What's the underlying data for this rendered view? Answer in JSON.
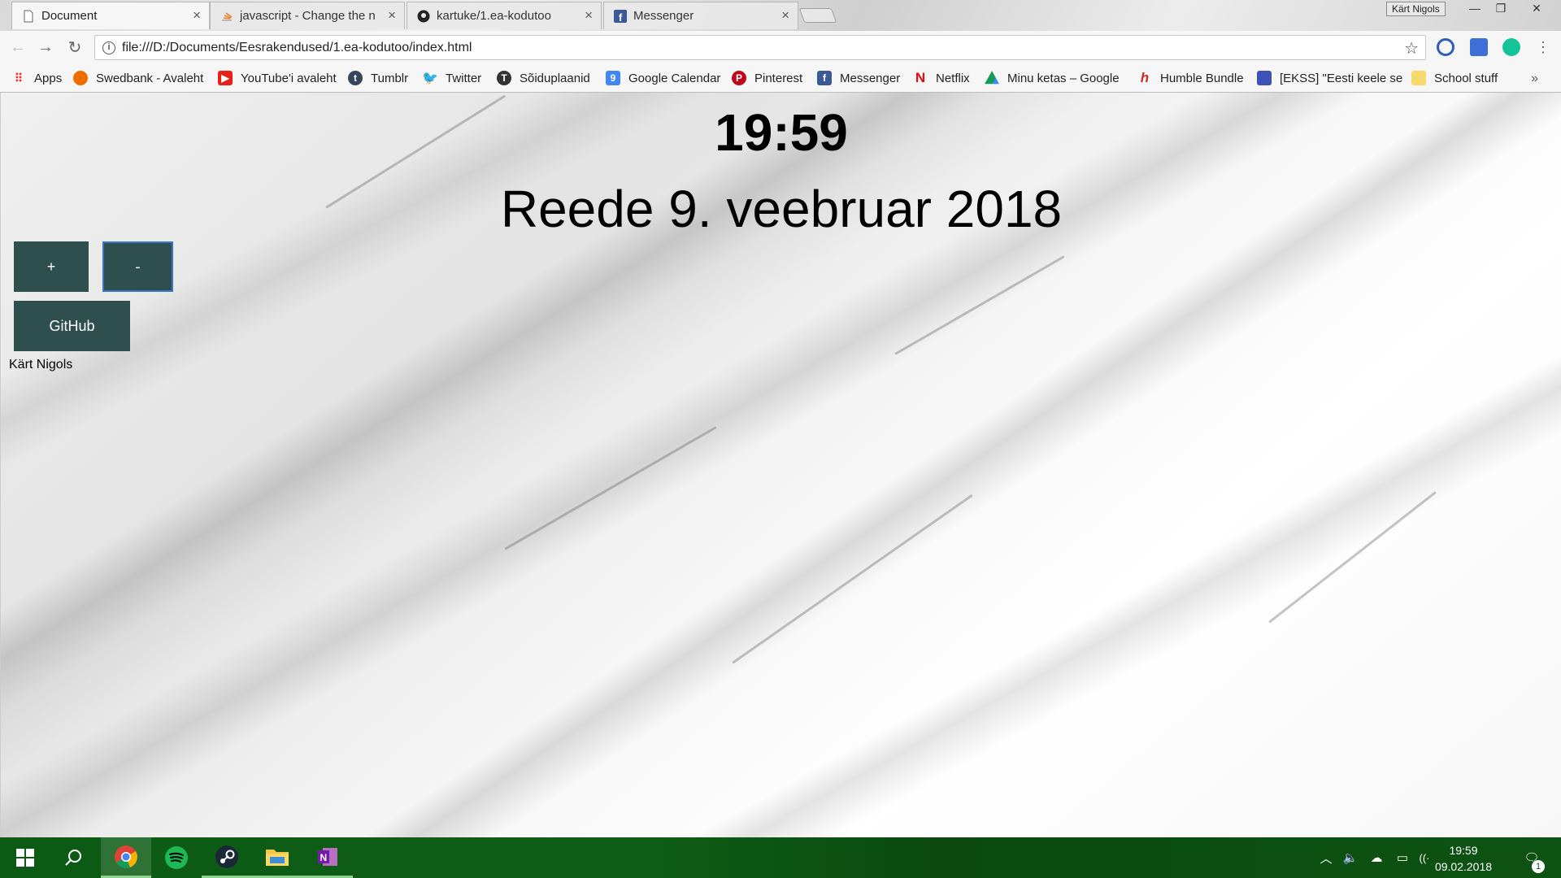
{
  "browser": {
    "tabs": [
      {
        "title": "Document",
        "icon": "page-icon"
      },
      {
        "title": "javascript - Change the n",
        "icon": "stackoverflow-icon"
      },
      {
        "title": "kartuke/1.ea-kodutoo",
        "icon": "github-icon"
      },
      {
        "title": "Messenger",
        "icon": "facebook-icon"
      }
    ],
    "profile": "Kärt Nigols",
    "url": "file:///D:/Documents/Eesrakendused/1.ea-kodutoo/index.html"
  },
  "bookmarks": [
    {
      "label": "Apps",
      "color": "#e53935"
    },
    {
      "label": "Swedbank - Avaleht",
      "color": "#ef6c00"
    },
    {
      "label": "YouTube'i avaleht",
      "color": "#e62117"
    },
    {
      "label": "Tumblr",
      "color": "#35465c"
    },
    {
      "label": "Twitter",
      "color": "#1da1f2"
    },
    {
      "label": "Sõiduplaanid",
      "color": "#333333"
    },
    {
      "label": "Google Calendar",
      "color": "#4285f4"
    },
    {
      "label": "Pinterest",
      "color": "#bd081c"
    },
    {
      "label": "Messenger",
      "color": "#3b5998"
    },
    {
      "label": "Netflix",
      "color": "#e50914"
    },
    {
      "label": "Minu ketas – Google",
      "color": "#0f9d58"
    },
    {
      "label": "Humble Bundle",
      "color": "#cc2929"
    },
    {
      "label": "[EKSS] \"Eesti keele se",
      "color": "#3f51b5"
    },
    {
      "label": "School stuff",
      "color": "#f6d86b"
    }
  ],
  "page": {
    "clock": "19:59",
    "date": "Reede 9. veebruar 2018",
    "plus_label": "+",
    "minus_label": "-",
    "github_label": "GitHub",
    "author": "Kärt Nigols",
    "button_color": "#2f4f4f"
  },
  "taskbar": {
    "time": "19:59",
    "date": "09.02.2018",
    "notifications": "1"
  }
}
